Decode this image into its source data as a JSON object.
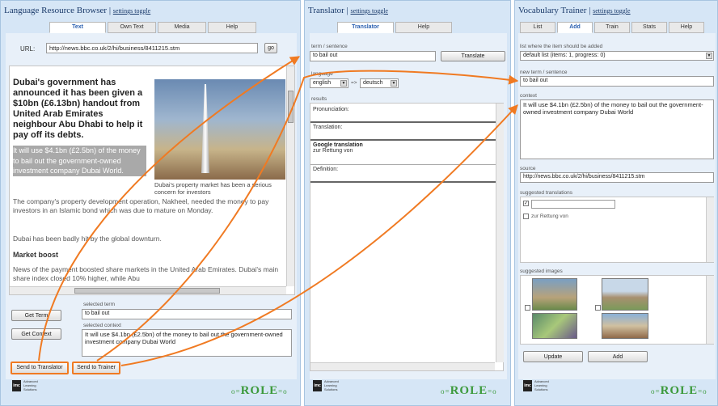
{
  "lrb": {
    "title": "Language Resource Browser",
    "settings": "settings toggle",
    "tabs": [
      "Text",
      "Own Text",
      "Media",
      "Help"
    ],
    "url_label": "URL:",
    "url_value": "http://news.bbc.co.uk/2/hi/business/8411215.stm",
    "go": "go",
    "article": {
      "lead": "Dubai's government has announced it has been given a $10bn (£6.13bn) handout from United Arab Emirates neighbour Abu Dhabi to help it pay off its debts.",
      "highlight": "It will use $4.1bn (£2.5bn) of the money to bail out the government-owned investment company Dubai World.",
      "caption": "Dubai's property market has been a serious concern for investors",
      "p1": "The company's property development operation, Nakheel, needed the money to pay investors in an Islamic bond which was due to mature on Monday.",
      "p2": "Dubai has been badly hit by the global downturn.",
      "heading": "Market boost",
      "p3": "News of the payment boosted share markets in the United Arab Emirates. Dubai's main share index closed 10% higher, while Abu"
    },
    "get_term": "Get Term",
    "get_context": "Get Context",
    "selected_term_label": "selected term",
    "selected_term": "to bail out",
    "selected_context_label": "selected context",
    "selected_context": "It will use $4.1bn (£2.5bn) of the money to bail out the government-owned investment company Dubai World",
    "send_translator": "Send to Translator",
    "send_trainer": "Send to Trainer"
  },
  "translator": {
    "title": "Translator",
    "settings": "settings toggle",
    "tabs": [
      "Translator",
      "Help"
    ],
    "term_label": "term / sentence",
    "term": "to bail out",
    "translate": "Translate",
    "language_label": "language",
    "from_lang": "english",
    "to_lang": "deutsch",
    "arrow": "=>",
    "results_label": "results",
    "pronunciation": "Pronunciation:",
    "translation": "Translation:",
    "google_label": "Google translation",
    "google_value": "zur Rettung von",
    "definition": "Definition:"
  },
  "trainer": {
    "title": "Vocabulary Trainer",
    "settings": "settings toggle",
    "tabs": [
      "List",
      "Add",
      "Train",
      "Stats",
      "Help"
    ],
    "list_label": "list where the item should be added",
    "list_value": "default list (items: 1, progress: 0)",
    "new_term_label": "new term / sentence",
    "new_term": "to bail out",
    "context_label": "context",
    "context_value": "It will use $4.1bn (£2.5bn) of the money to bail out the government-owned investment company Dubai World",
    "source_label": "source",
    "source_value": "http://news.bbc.co.uk/2/hi/business/8411215.stm",
    "suggested_translations_label": "suggested translations",
    "suggestion": "zur Rettung von",
    "suggested_images_label": "suggested images",
    "update": "Update",
    "add": "Add"
  },
  "logo": {
    "imc": "imc",
    "imc_text": "Advanced Learning Solutions",
    "role": "ROLE"
  },
  "colors": {
    "panel_bg": "#d6e6f6",
    "accent_orange": "#f07a22",
    "title_blue": "#1a3a6a"
  }
}
